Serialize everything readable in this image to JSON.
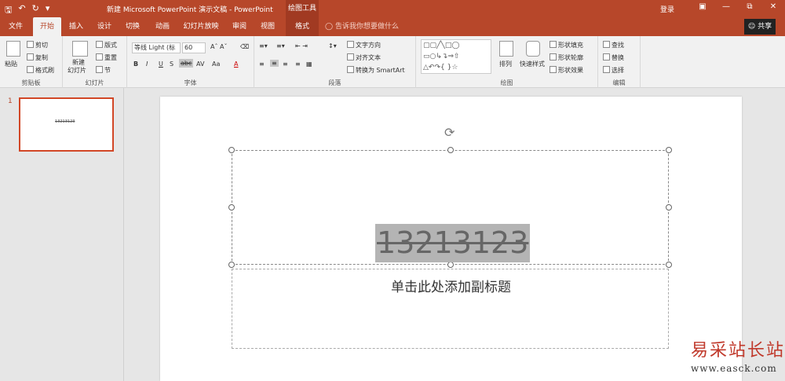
{
  "titlebar": {
    "quick_icons": [
      "save-icon",
      "undo-icon",
      "redo-icon",
      "customize-icon"
    ],
    "title": "新建 Microsoft PowerPoint 演示文稿  -  PowerPoint",
    "context_tools": "绘图工具",
    "login": "登录"
  },
  "tabs": [
    "文件",
    "开始",
    "插入",
    "设计",
    "切换",
    "动画",
    "幻灯片放映",
    "审阅",
    "视图",
    "格式"
  ],
  "tell_me": "告诉我你想要做什么",
  "share": "共享",
  "ribbon": {
    "clipboard": {
      "label": "剪贴板",
      "paste": "粘贴",
      "cut": "剪切",
      "copy": "复制",
      "format_painter": "格式刷"
    },
    "slides": {
      "label": "幻灯片",
      "new_slide_1": "新建",
      "new_slide_2": "幻灯片",
      "layout": "版式",
      "reset": "重置",
      "section": "节"
    },
    "font": {
      "label": "字体",
      "font_name": "等线 Light (标",
      "font_size": "60",
      "bold": "B",
      "italic": "I",
      "underline": "U",
      "shadow": "S",
      "strike": "abc",
      "spacing": "AV",
      "case": "Aa",
      "color": "A"
    },
    "paragraph": {
      "label": "段落",
      "text_direction": "文字方向",
      "align_text": "对齐文本",
      "smartart": "转换为 SmartArt"
    },
    "drawing": {
      "label": "绘图",
      "arrange": "排列",
      "quick_styles": "快速样式",
      "shape_fill": "形状填充",
      "shape_outline": "形状轮廓",
      "shape_effects": "形状效果"
    },
    "editing": {
      "label": "编辑",
      "find": "查找",
      "replace": "替换",
      "select": "选择"
    }
  },
  "slide_panel": {
    "number": "1",
    "thumb_text": "13213123"
  },
  "slide": {
    "title_text": "13213123",
    "subtitle_text": "单击此处添加副标题"
  },
  "watermark": {
    "line1": "易采站长站",
    "line2": "www.easck.com"
  }
}
